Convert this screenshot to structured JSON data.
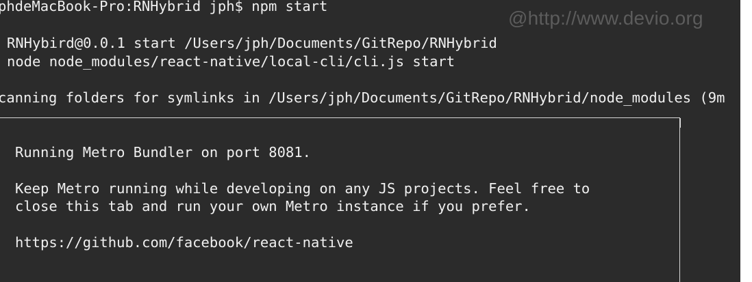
{
  "watermark": "@http://www.devio.org",
  "terminal": {
    "prompt_line": "phdeMacBook-Pro:RNHybrid jph$ npm start",
    "npm_line_1": "RNHybird@0.0.1 start /Users/jph/Documents/GitRepo/RNHybrid",
    "npm_line_2": "node node_modules/react-native/local-cli/cli.js start",
    "scanning_line": "canning folders for symlinks in /Users/jph/Documents/GitRepo/RNHybrid/node_modules (9m",
    "banner": {
      "running": "Running Metro Bundler on port 8081.",
      "keep_line_1": "Keep Metro running while developing on any JS projects. Feel free to",
      "keep_line_2": "close this tab and run your own Metro instance if you prefer.",
      "url": "https://github.com/facebook/react-native"
    }
  },
  "colors": {
    "background": "#2b2b2b",
    "text": "#f0f0f0",
    "border": "#d8d8d8",
    "watermark": "#5c5c5c"
  }
}
